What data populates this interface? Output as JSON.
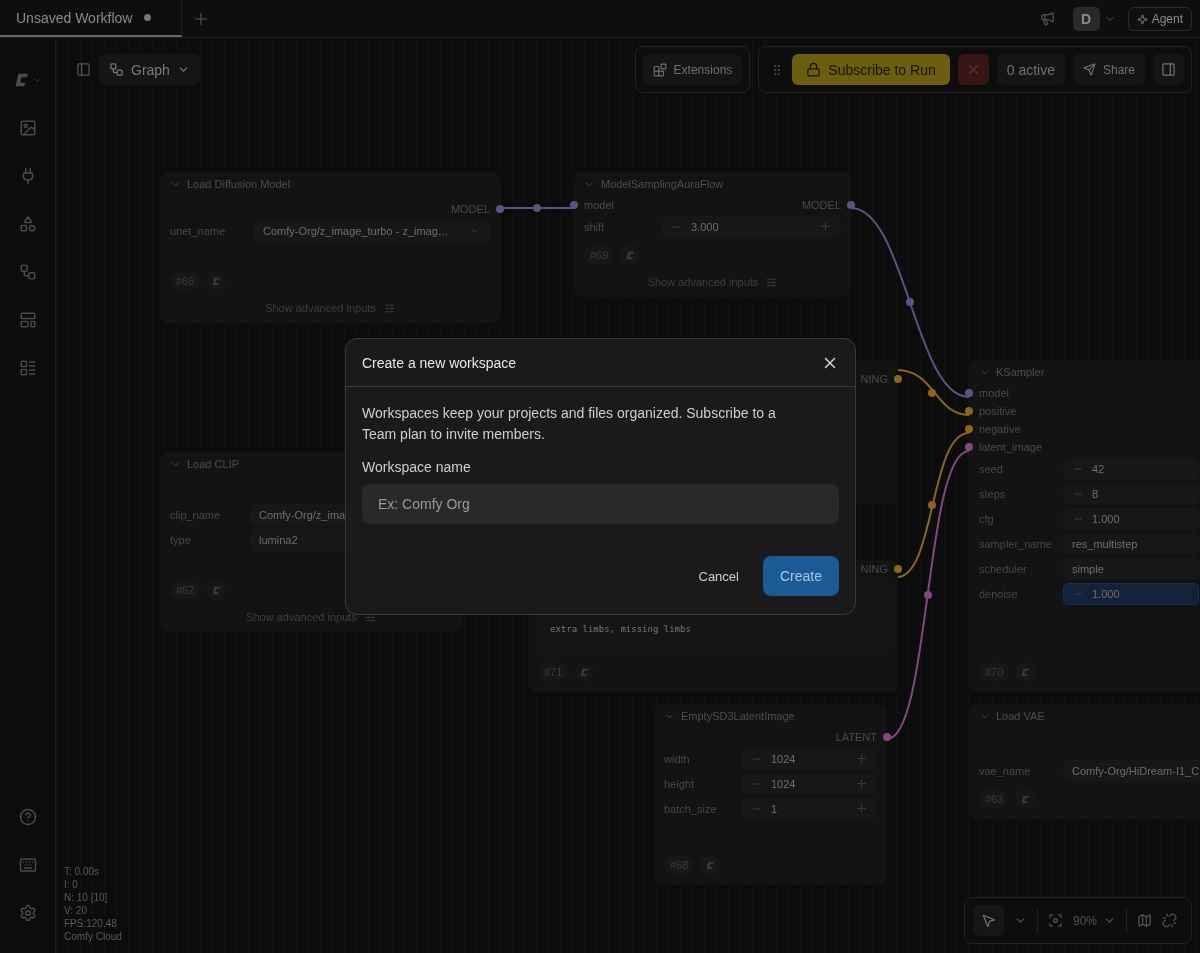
{
  "tab": {
    "title": "Unsaved Workflow",
    "unsaved": true
  },
  "header": {
    "avatar": "D",
    "agent_button": "Agent"
  },
  "toolbar": {
    "view_button": "Graph",
    "extensions_button": "Extensions",
    "run_button": "Subscribe to Run",
    "active_count": "0 active",
    "share_button": "Share"
  },
  "nodes": [
    {
      "title": "Load Diffusion Model",
      "outputs": [
        {
          "label": "MODEL",
          "color": "#5e5180"
        }
      ],
      "widgets": [
        {
          "kind": "combo",
          "label": "unet_name",
          "value": "Comfy-Org/z_image_turbo - z_imag…"
        }
      ],
      "id": "#66",
      "advanced": "Show advanced inputs"
    },
    {
      "title": "ModelSamplingAuraFlow",
      "inputs": [
        {
          "label": "model",
          "color": "#5e5180"
        }
      ],
      "outputs": [
        {
          "label": "MODEL",
          "color": "#5e5180"
        }
      ],
      "widgets": [
        {
          "kind": "number",
          "label": "shift",
          "value": "3.000"
        }
      ],
      "id": "#69",
      "advanced": "Show advanced inputs"
    },
    {
      "title": "Load CLIP",
      "widgets": [
        {
          "kind": "combo",
          "label": "clip_name",
          "value": "Comfy-Org/z_ima"
        },
        {
          "kind": "combo",
          "label": "type",
          "value": "lumina2"
        }
      ],
      "id": "#62",
      "advanced": "Show advanced inputs"
    },
    {
      "outputs": [
        {
          "label": "NING",
          "color": "#8a6424"
        }
      ]
    },
    {
      "outputs": [
        {
          "label": "NING",
          "color": "#8a6424"
        }
      ],
      "prompt": [
        "extra limbs, missing limbs"
      ],
      "id": "#71"
    },
    {
      "title": "KSampler",
      "inputs": [
        {
          "label": "model",
          "color": "#5e5180"
        },
        {
          "label": "positive",
          "color": "#8a6424"
        },
        {
          "label": "negative",
          "color": "#8a6424"
        },
        {
          "label": "latent_image",
          "color": "#7e4a7c"
        }
      ],
      "widgets": [
        {
          "kind": "number",
          "label": "seed",
          "value": "42",
          "highlighted": false
        },
        {
          "kind": "number",
          "label": "steps",
          "value": "8",
          "highlighted": false
        },
        {
          "kind": "number",
          "label": "cfg",
          "value": "1.000",
          "highlighted": false
        },
        {
          "kind": "combo",
          "label": "sampler_name",
          "value": "res_multistep",
          "highlighted": false
        },
        {
          "kind": "combo",
          "label": "scheduler",
          "value": "simple",
          "highlighted": false
        },
        {
          "kind": "number",
          "label": "denoise",
          "value": "1.000",
          "highlighted": true
        }
      ],
      "id": "#70"
    },
    {
      "title": "EmptySD3LatentImage",
      "outputs": [
        {
          "label": "LATENT",
          "color": "#7e4a7c"
        }
      ],
      "widgets": [
        {
          "kind": "number",
          "label": "width",
          "value": "1024"
        },
        {
          "kind": "number",
          "label": "height",
          "value": "1024"
        },
        {
          "kind": "number",
          "label": "batch_size",
          "value": "1"
        }
      ],
      "id": "#68"
    },
    {
      "title": "Load VAE",
      "widgets": [
        {
          "kind": "combo",
          "label": "vae_name",
          "value": "Comfy-Org/HiDream-I1_C"
        }
      ],
      "id": "#63"
    }
  ],
  "stats": [
    "T: 0.00s",
    "I: 0",
    "N: 10 [10]",
    "V: 20",
    "FPS:120.48",
    "Comfy Cloud"
  ],
  "zoom_control": {
    "zoom": "90%"
  },
  "dialog": {
    "title": "Create a new workspace",
    "description": "Workspaces keep your projects and files organized. Subscribe to a Team plan to invite members.",
    "field_label": "Workspace name",
    "placeholder": "Ex: Comfy Org",
    "cancel_button": "Cancel",
    "create_button": "Create"
  }
}
